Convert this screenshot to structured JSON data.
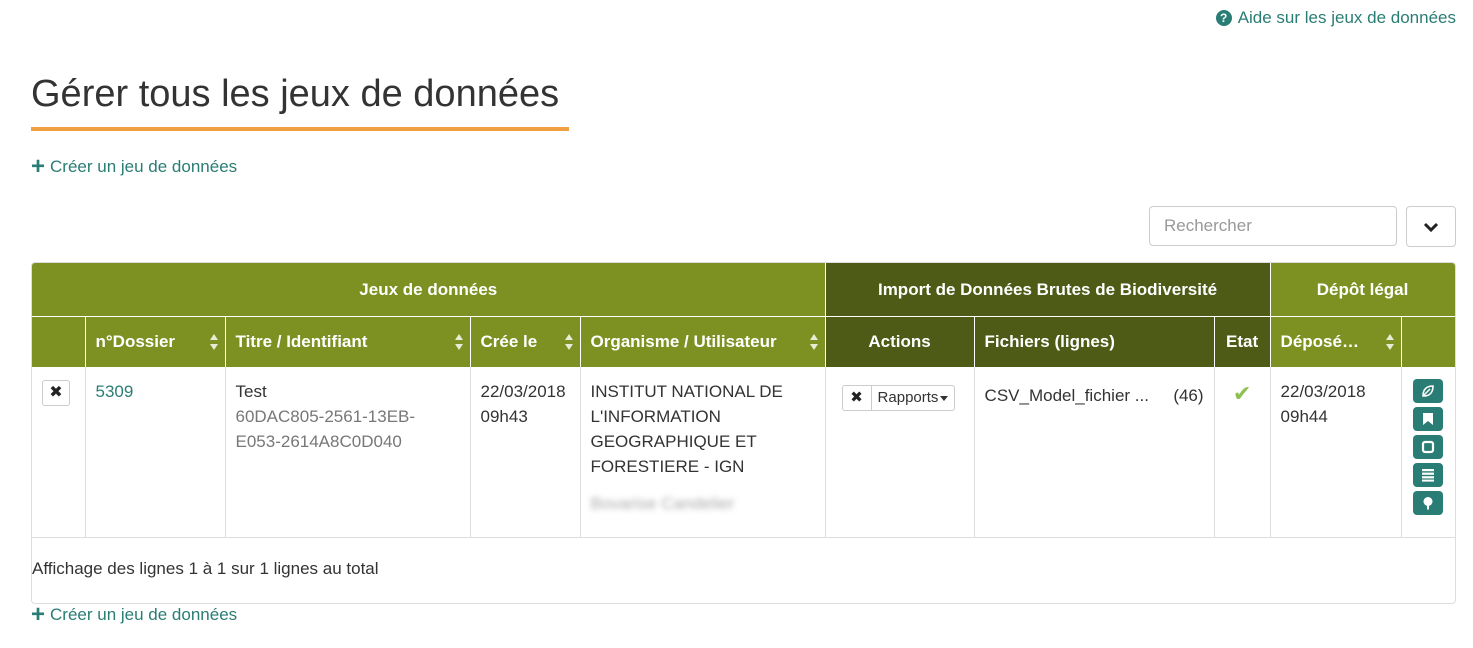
{
  "header": {
    "help_link": "Aide sur les jeux de données",
    "title": "Gérer tous les jeux de données",
    "create_link": "Créer un jeu de données"
  },
  "search": {
    "placeholder": "Rechercher"
  },
  "table": {
    "group_headers": [
      "Jeux de données",
      "Import de Données Brutes de Biodiversité",
      "Dépôt légal"
    ],
    "columns": [
      "n°Dossier",
      "Titre / Identifiant",
      "Crée le",
      "Organisme / Utilisateur",
      "Actions",
      "Fichiers (lignes)",
      "Etat",
      "Déposé…"
    ],
    "rows": [
      {
        "dossier": "5309",
        "title": "Test",
        "identifier_line1": "60DAC805-2561-13EB-",
        "identifier_line2": "E053-2614A8C0D040",
        "created_date": "22/03/2018",
        "created_time": "09h43",
        "organisme": "INSTITUT NATIONAL DE L'INFORMATION GEOGRAPHIQUE ET FORESTIERE - IGN",
        "utilisateur": "Bovarise Candelier",
        "actions_menu": "Rapports",
        "file_name": "CSV_Model_fichier ...",
        "file_lines": "(46)",
        "etat_icon": "check-icon",
        "deposit_date": "22/03/2018",
        "deposit_time": "09h44"
      }
    ]
  },
  "footer": {
    "pagination": "Affichage des lignes 1 à 1 sur 1 lignes au total",
    "create_link": "Créer un jeu de données"
  },
  "colors": {
    "accent": "#2a7d74",
    "olive": "#7d9123",
    "dark_olive": "#4d5b16",
    "underline": "#f0a040",
    "check": "#8cc152"
  }
}
